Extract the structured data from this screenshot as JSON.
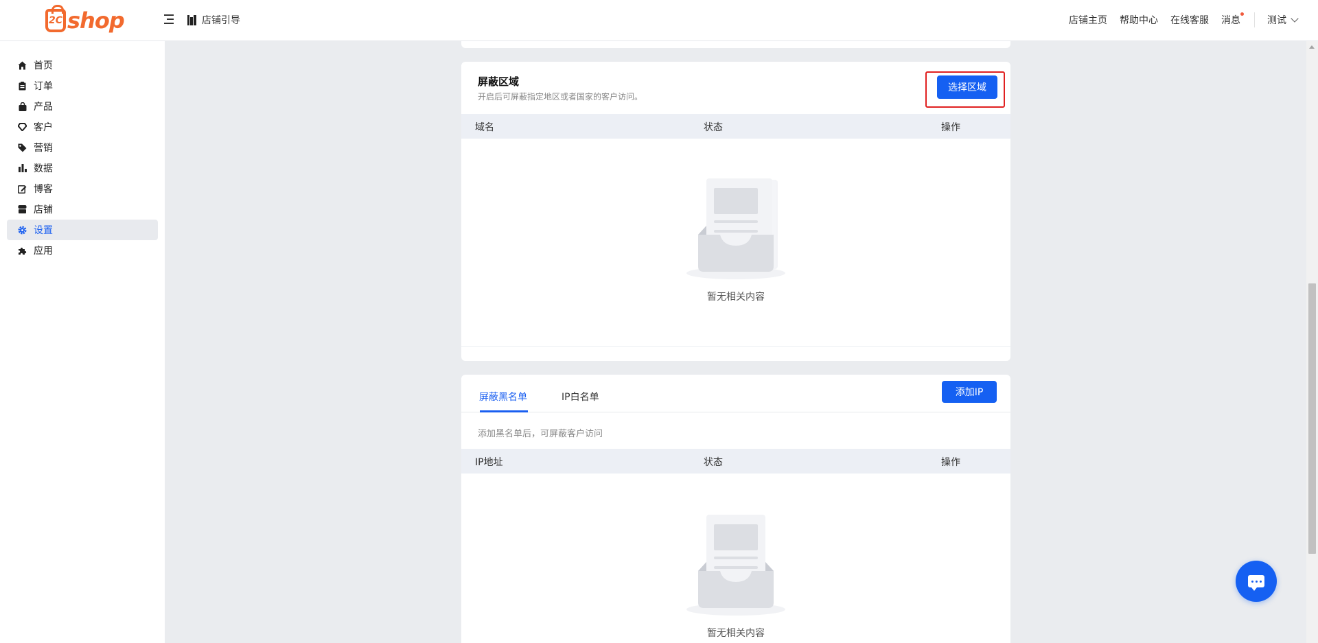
{
  "header": {
    "logo_text": "shop",
    "logo_mark_text": "2C",
    "guide_label": "店铺引导",
    "nav": [
      "店铺主页",
      "帮助中心",
      "在线客服",
      "消息"
    ],
    "user_name": "测试"
  },
  "sidebar": {
    "items": [
      {
        "label": "首页",
        "icon": "home-icon"
      },
      {
        "label": "订单",
        "icon": "clipboard-icon"
      },
      {
        "label": "产品",
        "icon": "bag-icon"
      },
      {
        "label": "客户",
        "icon": "diamond-icon"
      },
      {
        "label": "营销",
        "icon": "tag-icon"
      },
      {
        "label": "数据",
        "icon": "bar-chart-icon"
      },
      {
        "label": "博客",
        "icon": "edit-icon"
      },
      {
        "label": "店铺",
        "icon": "store-icon"
      },
      {
        "label": "设置",
        "icon": "gear-icon",
        "active": true
      },
      {
        "label": "应用",
        "icon": "puzzle-icon"
      }
    ]
  },
  "region_card": {
    "title": "屏蔽区域",
    "description": "开启后可屏蔽指定地区或者国家的客户访问。",
    "select_button": "选择区域",
    "columns": [
      "域名",
      "状态",
      "操作"
    ],
    "empty_text": "暂无相关内容"
  },
  "ip_card": {
    "tabs": [
      "屏蔽黑名单",
      "IP白名单"
    ],
    "active_tab": 0,
    "add_button": "添加IP",
    "description": "添加黑名单后，可屏蔽客户访问",
    "columns": [
      "IP地址",
      "状态",
      "操作"
    ],
    "empty_text": "暂无相关内容"
  },
  "colors": {
    "brand": "#f26a2e",
    "primary": "#1560f2",
    "highlight": "#e02020"
  }
}
